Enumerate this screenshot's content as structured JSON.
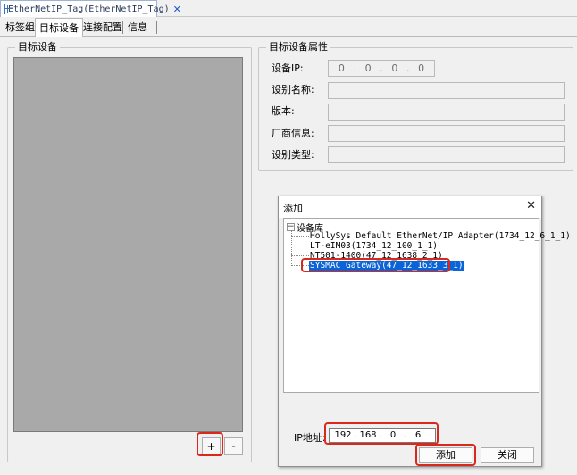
{
  "doc_tab": {
    "title": "EtherNetIP_Tag(EtherNetIP_Tag)",
    "close": "✕",
    "icon": "table-icon"
  },
  "sub_tabs": [
    {
      "label": "标签组"
    },
    {
      "label": "目标设备"
    },
    {
      "label": "连接配置"
    },
    {
      "label": "信息"
    }
  ],
  "target_devices": {
    "group_label": "目标设备",
    "add_button": "+",
    "remove_button": "-"
  },
  "properties": {
    "group_label": "目标设备属性",
    "ip_label": "设备IP:",
    "ip_octets": [
      "0",
      "0",
      "0",
      "0"
    ],
    "name_label": "设别名称:",
    "version_label": "版本:",
    "vendor_label": "厂商信息:",
    "type_label": "设别类型:"
  },
  "dialog": {
    "title": "添加",
    "close": "✕",
    "tree": {
      "root_label": "设备库",
      "root_expander": "−",
      "items": [
        "HollySys Default EtherNet/IP Adapter(1734_12_6_1_1)",
        "LT-eIM03(1734_12_100_1_1)",
        "NT501-1400(47_12_1638_2_1)",
        "SYSMAC Gateway(47_12_1633_3_1)"
      ],
      "selected_index": 3
    },
    "ip_label": "IP地址:",
    "ip_octets": [
      "192",
      "168",
      "0",
      "6"
    ],
    "ip_dot": ".",
    "add_button": "添加",
    "close_button": "关闭"
  },
  "colors": {
    "highlight": "#d9281c",
    "selection": "#0a64d8",
    "list_background": "#a9a9a9"
  }
}
